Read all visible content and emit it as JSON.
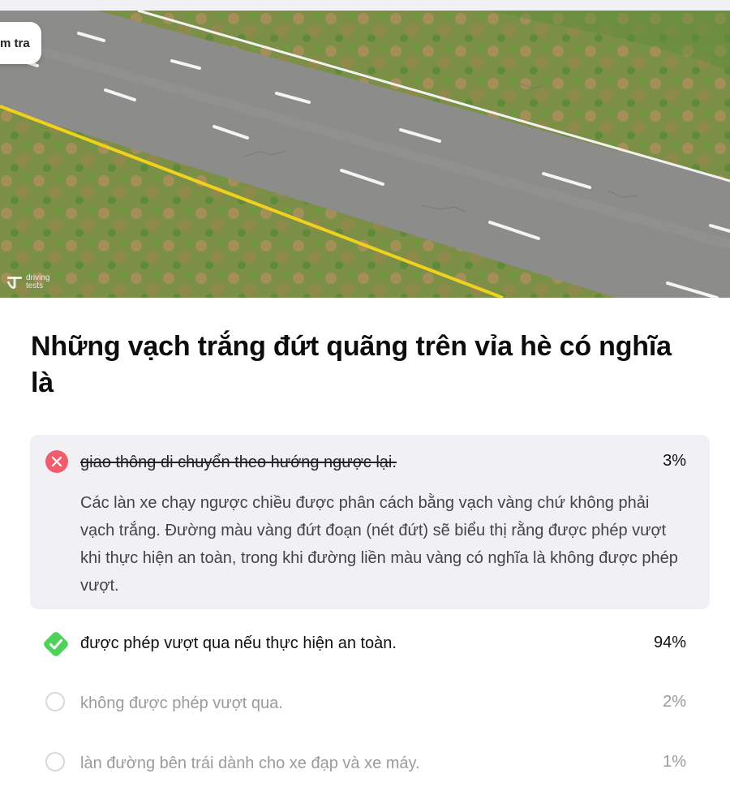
{
  "hero": {
    "check_tag": "m tra",
    "watermark_line1": "driving",
    "watermark_line2": "tests"
  },
  "question": {
    "title": "Những vạch trắng đứt quãng trên vỉa hè có nghĩa là"
  },
  "answers": [
    {
      "text": "giao thông di chuyển theo hướng ngược lại.",
      "percent": "3%",
      "status": "incorrect",
      "icon": "x-circle-icon",
      "explanation": "Các làn xe chạy ngược chiều được phân cách bằng vạch vàng chứ không phải vạch trắng. Đường màu vàng đứt đoạn (nét đứt) sẽ biểu thị rằng được phép vượt khi thực hiện an toàn, trong khi đường liền màu vàng có nghĩa là không được phép vượt."
    },
    {
      "text": "được phép vượt qua nếu thực hiện an toàn.",
      "percent": "94%",
      "status": "correct",
      "icon": "check-diamond-icon"
    },
    {
      "text": "không được phép vượt qua.",
      "percent": "2%",
      "status": "unselected",
      "icon": "circle-icon"
    },
    {
      "text": "làn đường bên trái dành cho xe đạp và xe máy.",
      "percent": "1%",
      "status": "unselected",
      "icon": "circle-icon"
    }
  ],
  "colors": {
    "incorrect": "#f25d6b",
    "correct": "#4ed35a",
    "card_bg": "#f1f1f5",
    "road_yellow": "#f0d21e"
  }
}
